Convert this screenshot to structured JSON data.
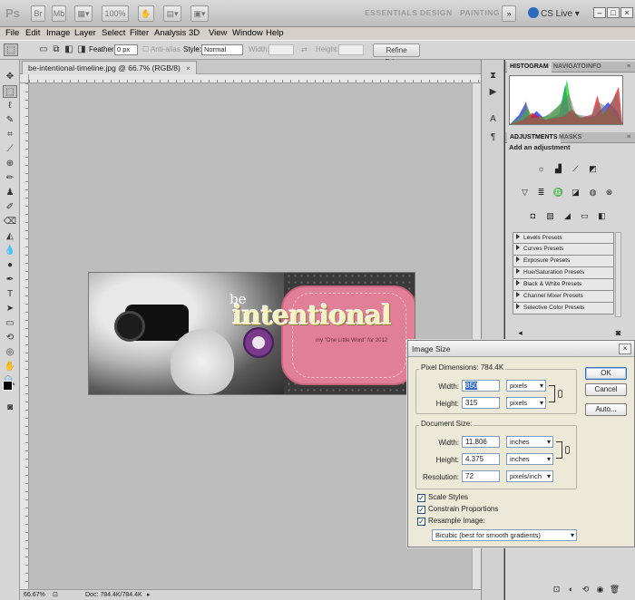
{
  "app": {
    "logo": "Ps",
    "zoom": "100%",
    "workspaces": [
      "ESSENTIALS",
      "DESIGN",
      "PAINTING"
    ],
    "more": "»",
    "cs_live": "CS Live"
  },
  "menu": [
    "File",
    "Edit",
    "Image",
    "Layer",
    "Select",
    "Filter",
    "Analysis",
    "3D",
    "View",
    "Window",
    "Help"
  ],
  "options": {
    "feather_label": "Feather:",
    "feather_value": "0 px",
    "antialias": "Anti-alias",
    "style_label": "Style:",
    "style_value": "Normal",
    "width_label": "Width:",
    "height_label": "Height:",
    "refine": "Refine Edge..."
  },
  "document": {
    "tab": "be-intentional-timeline.jpg @ 66.7% (RGB/8)",
    "close": "×",
    "image_be": "be",
    "image_title": "intentional",
    "image_sub": "my \"One Little Word\" for 2012"
  },
  "status": {
    "zoom": "66.67%",
    "doc": "Doc: 784.4K/784.4K"
  },
  "panels": {
    "histogram_tabs": [
      "HISTOGRAM",
      "NAVIGATO",
      "INFO"
    ],
    "adjust_tabs": [
      "ADJUSTMENTS",
      "MASKS"
    ],
    "add_adjustment": "Add an adjustment",
    "presets": [
      "Levels Presets",
      "Curves Presets",
      "Exposure Presets",
      "Hue/Saturation Presets",
      "Black & White Presets",
      "Channel Mixer Presets",
      "Selective Color Presets"
    ]
  },
  "dialog": {
    "title": "Image Size",
    "close": "×",
    "pixel_dims": "Pixel Dimensions:",
    "pixel_dims_value": "784.4K",
    "px_width_label": "Width:",
    "px_width": "850",
    "px_width_unit": "pixels",
    "px_height_label": "Height:",
    "px_height": "315",
    "px_height_unit": "pixels",
    "doc_size": "Document Size:",
    "doc_width_label": "Width:",
    "doc_width": "11.806",
    "doc_width_unit": "inches",
    "doc_height_label": "Height:",
    "doc_height": "4.375",
    "doc_height_unit": "inches",
    "resolution_label": "Resolution:",
    "resolution": "72",
    "resolution_unit": "pixels/inch",
    "scale_styles": "Scale Styles",
    "constrain": "Constrain Proportions",
    "resample": "Resample Image:",
    "resample_method": "Bicubic (best for smooth gradients)",
    "ok": "OK",
    "cancel": "Cancel",
    "auto": "Auto...",
    "check": "✓"
  }
}
